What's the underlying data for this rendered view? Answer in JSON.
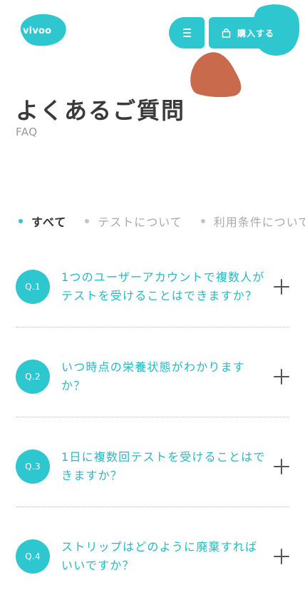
{
  "header": {
    "logo_text": "vivoo",
    "buy_label": "購入する",
    "colors": {
      "accent": "#2ec7d0",
      "deco": "#c96a4d"
    }
  },
  "page": {
    "title": "よくあるご質問",
    "subtitle": "FAQ"
  },
  "filters": [
    {
      "label": "すべて",
      "active": true
    },
    {
      "label": "テストについて",
      "active": false
    },
    {
      "label": "利用条件について",
      "active": false
    }
  ],
  "faq": [
    {
      "badge": "Q.1",
      "question": "1つのユーザーアカウントで複数人がテストを受けることはできますか？"
    },
    {
      "badge": "Q.2",
      "question": "いつ時点の栄養状態がわかりますか？"
    },
    {
      "badge": "Q.3",
      "question": "1日に複数回テストを受けることはできますか？"
    },
    {
      "badge": "Q.4",
      "question": "ストリップはどのように廃棄すればいいですか？"
    }
  ]
}
